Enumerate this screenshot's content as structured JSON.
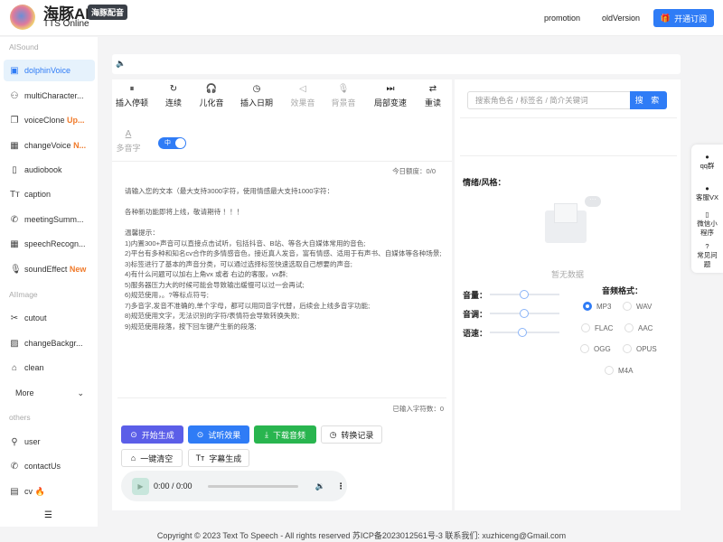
{
  "header": {
    "title": "海豚AI",
    "badge": "海豚配音",
    "subtitle": "TTS Online",
    "links": [
      "promotion",
      "oldVersion"
    ],
    "subscribe": "开通订阅"
  },
  "sidebar": {
    "sections": [
      "AISound",
      "AIImage",
      "others"
    ],
    "items": [
      {
        "label": "dolphinVoice",
        "icon": "image-icon"
      },
      {
        "label": "multiCharacter...",
        "icon": "users-icon"
      },
      {
        "label": "voiceClone",
        "tag": "Up..."
      },
      {
        "label": "changeVoice",
        "tag": "N..."
      },
      {
        "label": "audiobook"
      },
      {
        "label": "caption"
      },
      {
        "label": "meetingSumm..."
      },
      {
        "label": "speechRecogn..."
      },
      {
        "label": "soundEffect",
        "tag": "New"
      },
      {
        "label": "cutout"
      },
      {
        "label": "changeBackgr..."
      },
      {
        "label": "clean"
      },
      {
        "label": "More"
      },
      {
        "label": "user"
      },
      {
        "label": "contactUs"
      },
      {
        "label": "cv",
        "tag": "🔥"
      }
    ]
  },
  "toolbar": [
    "插入停顿",
    "连续",
    "儿化音",
    "插入日期",
    "效果音",
    "背景音",
    "局部变速",
    "重读"
  ],
  "polyphone": {
    "label": "多音字",
    "toggle": "中"
  },
  "quota": "今日额度：0/0",
  "editor_placeholder": "请输入您的文本（最大支持3000字符，使用情感最大支持1000字符：\n\n各种新功能即将上线，敬请期待 ！！！\n\n温馨提示：\n1)内置300+声音可以直接点击试听，包括抖音、B站、等各大自媒体常用的音色;\n2)平台有多种和知名cv合作的多情感音色，接近真人发音，富有情感、适用于有声书、自媒体等各种场景;\n3)标签进行了基本的声音分类，可以通过选择标签快速选取自己想要的声音;\n4)有什么问题可以加右上角vx 或者 右边的客服，vx群;\n5)服务器压力大的时候可能会导致输出缓慢可以过一会再试;\n6)规范使用，。?等标点符号;\n7)多音字,发音不准确的,单个字母，都可以用同音字代替，后续会上线多音字功能;\n8)规范使用文字，无法识别的字符/表情符会导致转换失败;\n9)规范使用段落，按下回车键产生新的段落;",
  "char_count": "已输入字符数：0",
  "buttons": {
    "generate": "开始生成",
    "preview": "试听效果",
    "download": "下载音频",
    "history": "转换记录",
    "clear": "一键清空",
    "subtitle": "字幕生成"
  },
  "player": {
    "time": "0:00 / 0:00"
  },
  "right": {
    "search_placeholder": "搜索角色名 / 标签名 / 简介关键词",
    "search_btn": "搜 索",
    "emotion_label": "情绪/风格：",
    "empty": "暂无数据",
    "sliders": [
      {
        "label": "音量：",
        "value": 0.5
      },
      {
        "label": "音调：",
        "value": 0.5
      },
      {
        "label": "语速：",
        "value": 0.47
      }
    ],
    "format_label": "音频格式：",
    "formats": [
      "MP3",
      "WAV",
      "FLAC",
      "AAC",
      "OGG",
      "OPUS",
      "M4A"
    ],
    "selected_format": "MP3"
  },
  "float": [
    "qq群",
    "客服VX",
    "微信小程序",
    "常见问题"
  ],
  "footer": "Copyright © 2023 Text To Speech - All rights reserved  苏ICP备2023012561号-3   联系我们: xuzhiceng@Gmail.com",
  "colors": {
    "primary": "#2f7cf6",
    "generate": "#5b5ee8",
    "download": "#29b54f",
    "accent": "#f07a2a"
  }
}
